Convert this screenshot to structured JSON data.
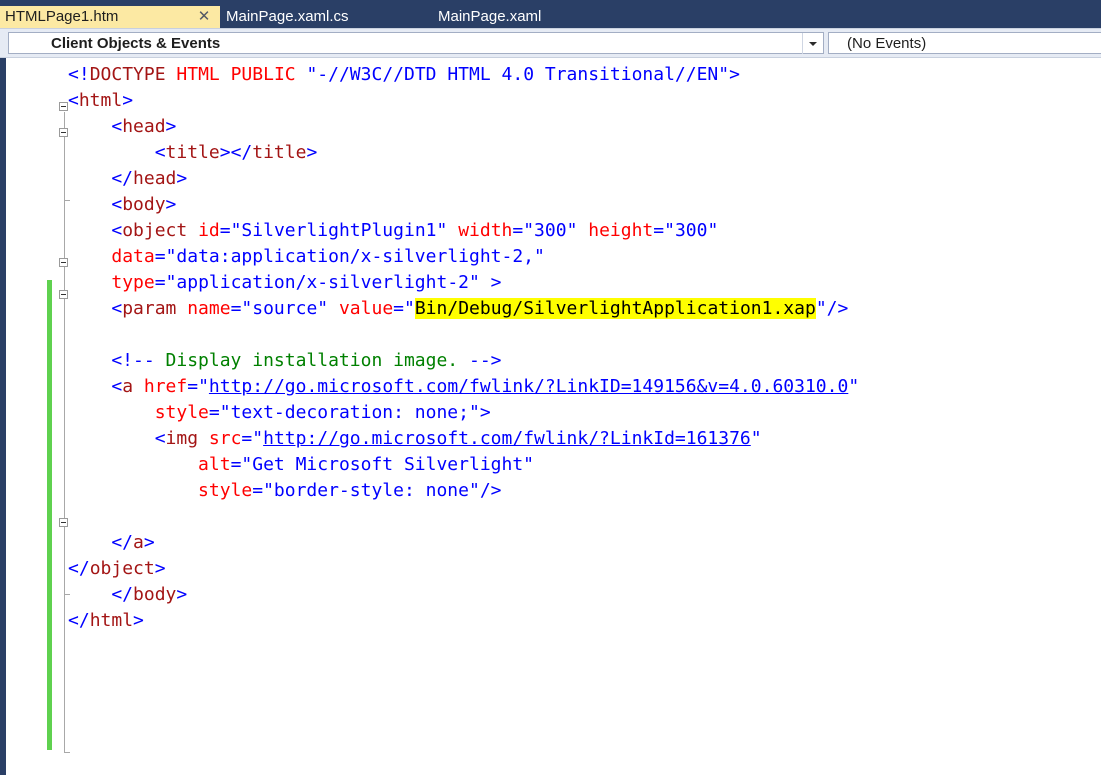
{
  "tabs": [
    {
      "label": "HTMLPage1.htm",
      "active": true
    },
    {
      "label": "MainPage.xaml.cs",
      "active": false
    },
    {
      "label": "MainPage.xaml",
      "active": false
    }
  ],
  "tab_close_glyph": "✕",
  "navbar": {
    "objects_label": "Client Objects & Events",
    "events_label": "(No Events)"
  },
  "colors": {
    "tab_strip": "#2a3f66",
    "active_tab": "#fce9a3",
    "change_bar": "#5fd14f",
    "highlight": "#ffff00",
    "html_tag": "#a31515",
    "attribute": "#ff0000",
    "attribute_value": "#0000ff",
    "comment": "#008000"
  },
  "code": {
    "lines": [
      [
        {
          "t": "<!",
          "c": "br"
        },
        {
          "t": "DOCTYPE",
          "c": "tag"
        },
        {
          "t": " ",
          "c": "pl"
        },
        {
          "t": "HTML",
          "c": "attr"
        },
        {
          "t": " ",
          "c": "pl"
        },
        {
          "t": "PUBLIC",
          "c": "attr"
        },
        {
          "t": " \"-//W3C//DTD HTML 4.0 Transitional//EN\">",
          "c": "val"
        }
      ],
      [
        {
          "t": "<",
          "c": "br"
        },
        {
          "t": "html",
          "c": "tag"
        },
        {
          "t": ">",
          "c": "br"
        }
      ],
      [
        {
          "t": "    <",
          "c": "br"
        },
        {
          "t": "head",
          "c": "tag"
        },
        {
          "t": ">",
          "c": "br"
        }
      ],
      [
        {
          "t": "        <",
          "c": "br"
        },
        {
          "t": "title",
          "c": "tag"
        },
        {
          "t": "></",
          "c": "br"
        },
        {
          "t": "title",
          "c": "tag"
        },
        {
          "t": ">",
          "c": "br"
        }
      ],
      [
        {
          "t": "    </",
          "c": "br"
        },
        {
          "t": "head",
          "c": "tag"
        },
        {
          "t": ">",
          "c": "br"
        }
      ],
      [
        {
          "t": "    <",
          "c": "br"
        },
        {
          "t": "body",
          "c": "tag"
        },
        {
          "t": ">",
          "c": "br"
        }
      ],
      [
        {
          "t": "    <",
          "c": "br"
        },
        {
          "t": "object",
          "c": "tag"
        },
        {
          "t": " ",
          "c": "pl"
        },
        {
          "t": "id",
          "c": "attr"
        },
        {
          "t": "=",
          "c": "br"
        },
        {
          "t": "\"SilverlightPlugin1\"",
          "c": "val"
        },
        {
          "t": " ",
          "c": "pl"
        },
        {
          "t": "width",
          "c": "attr"
        },
        {
          "t": "=",
          "c": "br"
        },
        {
          "t": "\"300\"",
          "c": "val"
        },
        {
          "t": " ",
          "c": "pl"
        },
        {
          "t": "height",
          "c": "attr"
        },
        {
          "t": "=",
          "c": "br"
        },
        {
          "t": "\"300\"",
          "c": "val"
        }
      ],
      [
        {
          "t": "    ",
          "c": "pl"
        },
        {
          "t": "data",
          "c": "attr"
        },
        {
          "t": "=",
          "c": "br"
        },
        {
          "t": "\"data:application/x-silverlight-2,\"",
          "c": "val"
        }
      ],
      [
        {
          "t": "    ",
          "c": "pl"
        },
        {
          "t": "type",
          "c": "attr"
        },
        {
          "t": "=",
          "c": "br"
        },
        {
          "t": "\"application/x-silverlight-2\"",
          "c": "val"
        },
        {
          "t": " >",
          "c": "br"
        }
      ],
      [
        {
          "t": "    <",
          "c": "br"
        },
        {
          "t": "param",
          "c": "tag"
        },
        {
          "t": " ",
          "c": "pl"
        },
        {
          "t": "name",
          "c": "attr"
        },
        {
          "t": "=",
          "c": "br"
        },
        {
          "t": "\"source\"",
          "c": "val"
        },
        {
          "t": " ",
          "c": "pl"
        },
        {
          "t": "value",
          "c": "attr"
        },
        {
          "t": "=",
          "c": "br"
        },
        {
          "t": "\"",
          "c": "val"
        },
        {
          "t": "Bin/Debug/SilverlightApplication1.xap",
          "c": "hl"
        },
        {
          "t": "\"",
          "c": "val"
        },
        {
          "t": "/>",
          "c": "br"
        }
      ],
      [],
      [
        {
          "t": "    <!--",
          "c": "br"
        },
        {
          "t": " Display installation image. ",
          "c": "com"
        },
        {
          "t": "-->",
          "c": "br"
        }
      ],
      [
        {
          "t": "    <",
          "c": "br"
        },
        {
          "t": "a",
          "c": "tag"
        },
        {
          "t": " ",
          "c": "pl"
        },
        {
          "t": "href",
          "c": "attr"
        },
        {
          "t": "=",
          "c": "br"
        },
        {
          "t": "\"",
          "c": "val"
        },
        {
          "t": "http://go.microsoft.com/fwlink/?LinkID=149156&v=4.0.60310.0",
          "c": "url"
        },
        {
          "t": "\"",
          "c": "val"
        }
      ],
      [
        {
          "t": "        ",
          "c": "pl"
        },
        {
          "t": "style",
          "c": "attr"
        },
        {
          "t": "=",
          "c": "br"
        },
        {
          "t": "\"text-decoration: none;\"",
          "c": "val"
        },
        {
          "t": ">",
          "c": "br"
        }
      ],
      [
        {
          "t": "        <",
          "c": "br"
        },
        {
          "t": "img",
          "c": "tag"
        },
        {
          "t": " ",
          "c": "pl"
        },
        {
          "t": "src",
          "c": "attr"
        },
        {
          "t": "=",
          "c": "br"
        },
        {
          "t": "\"",
          "c": "val"
        },
        {
          "t": "http://go.microsoft.com/fwlink/?LinkId=161376",
          "c": "url"
        },
        {
          "t": "\"",
          "c": "val"
        }
      ],
      [
        {
          "t": "            ",
          "c": "pl"
        },
        {
          "t": "alt",
          "c": "attr"
        },
        {
          "t": "=",
          "c": "br"
        },
        {
          "t": "\"Get Microsoft Silverlight\"",
          "c": "val"
        }
      ],
      [
        {
          "t": "            ",
          "c": "pl"
        },
        {
          "t": "style",
          "c": "attr"
        },
        {
          "t": "=",
          "c": "br"
        },
        {
          "t": "\"border-style: none\"",
          "c": "val"
        },
        {
          "t": "/>",
          "c": "br"
        }
      ],
      [],
      [
        {
          "t": "    </",
          "c": "br"
        },
        {
          "t": "a",
          "c": "tag"
        },
        {
          "t": ">",
          "c": "br"
        }
      ],
      [
        {
          "t": "</",
          "c": "br"
        },
        {
          "t": "object",
          "c": "tag"
        },
        {
          "t": ">",
          "c": "br"
        }
      ],
      [
        {
          "t": "    </",
          "c": "br"
        },
        {
          "t": "body",
          "c": "tag"
        },
        {
          "t": ">",
          "c": "br"
        }
      ],
      [
        {
          "t": "</",
          "c": "br"
        },
        {
          "t": "html",
          "c": "tag"
        },
        {
          "t": ">",
          "c": "br"
        }
      ]
    ]
  }
}
